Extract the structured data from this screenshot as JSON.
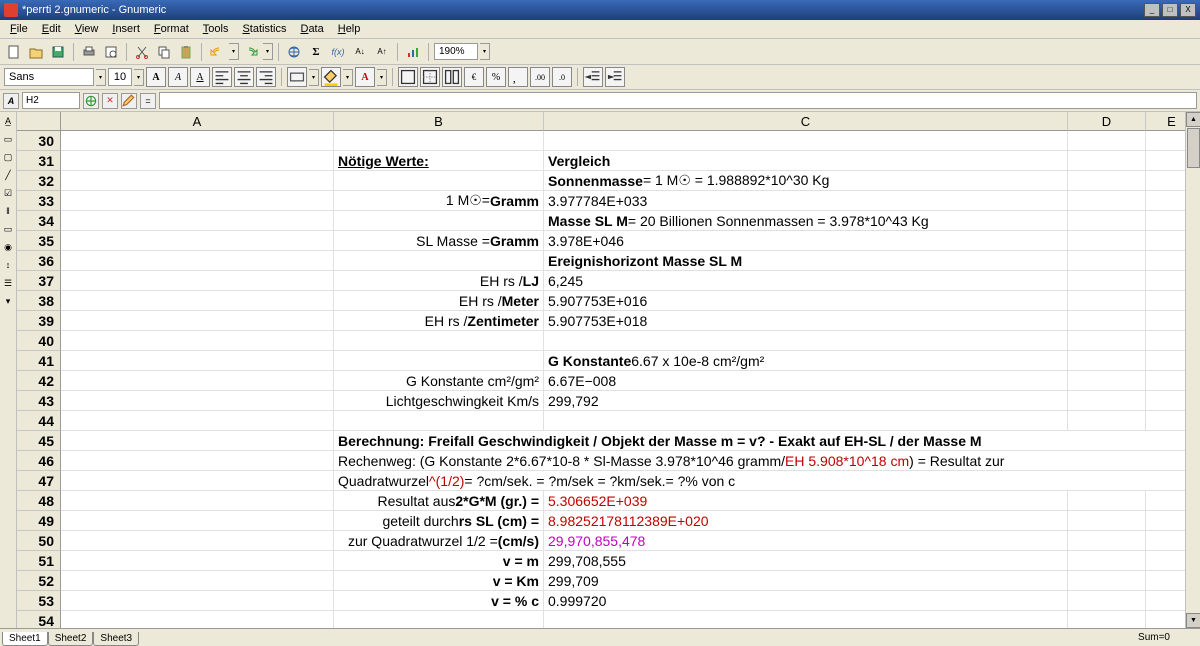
{
  "app": {
    "title": "*perrti 2.gnumeric - Gnumeric",
    "window_buttons": {
      "min": "_",
      "max": "□",
      "close": "X"
    }
  },
  "menus": [
    "File",
    "Edit",
    "View",
    "Insert",
    "Format",
    "Tools",
    "Statistics",
    "Data",
    "Help"
  ],
  "zoom": "190%",
  "font": {
    "name": "Sans",
    "size": "10"
  },
  "cellref": "H2",
  "columns": [
    "A",
    "B",
    "C",
    "D",
    "E"
  ],
  "rows_start": 30,
  "rows_count": 26,
  "cells": {
    "31": {
      "B": {
        "t": "Nötige Werte:",
        "cls": "bold uline"
      },
      "C": {
        "t": "Vergleich",
        "cls": "bold"
      }
    },
    "32": {
      "C": {
        "html": "<b>Sonnenmasse</b> = 1 M☉ = 1.988892*10^30 Kg"
      }
    },
    "33": {
      "B": {
        "html": "1 M☉= <b>Gramm</b>",
        "cls": "right"
      },
      "C": {
        "t": "3.977784E+033"
      }
    },
    "34": {
      "C": {
        "html": "<b>Masse SL M</b> = 20 Billionen Sonnenmassen = 3.978*10^43 Kg"
      }
    },
    "35": {
      "B": {
        "html": "SL Masse = <b>Gramm</b>",
        "cls": "right"
      },
      "C": {
        "t": "3.978E+046"
      }
    },
    "36": {
      "C": {
        "t": "Ereignishorizont Masse SL M",
        "cls": "bold"
      }
    },
    "37": {
      "B": {
        "html": "EH rs / <b>LJ</b>",
        "cls": "right"
      },
      "C": {
        "t": "6,245"
      }
    },
    "38": {
      "B": {
        "html": "EH rs / <b>Meter</b>",
        "cls": "right"
      },
      "C": {
        "t": "5.907753E+016"
      }
    },
    "39": {
      "B": {
        "html": "EH rs / <b>Zentimeter</b>",
        "cls": "right"
      },
      "C": {
        "t": "5.907753E+018"
      }
    },
    "41": {
      "C": {
        "html": "<b>G Konstante</b> 6.67 x 10e-8 cm²/gm²"
      }
    },
    "42": {
      "B": {
        "t": "G Konstante cm²/gm²",
        "cls": "right"
      },
      "C": {
        "t": "6.67E−008"
      }
    },
    "43": {
      "B": {
        "t": "Lichtgeschwingkeit Km/s",
        "cls": "right"
      },
      "C": {
        "t": "299,792"
      }
    },
    "45": {
      "B": {
        "t": "Berechnung: Freifall Geschwindigkeit / Objekt der Masse m = v? - Exakt auf  EH-SL / der Masse M",
        "cls": "bold",
        "span": true
      }
    },
    "46": {
      "B": {
        "html": "Rechenweg: (G Konstante 2*6.67*10-8 * Sl-Masse 3.978*10^46 gramm/<span class='red'>EH 5.908*10^18 cm</span> ) = Resultat zur",
        "span": true
      }
    },
    "47": {
      "B": {
        "html": "Quadratwurzel <span class='red'>^(1/2)</span> = ?cm/sek. = ?m/sek = ?km/sek.= ?% von c",
        "span": true
      }
    },
    "48": {
      "B": {
        "html": "Resultat aus <b>2*G*M (gr.) =</b>",
        "cls": "right"
      },
      "C": {
        "t": "5.306652E+039",
        "cls": "red"
      }
    },
    "49": {
      "B": {
        "html": "geteilt durch <b>rs SL (cm) =</b>",
        "cls": "right"
      },
      "C": {
        "t": "8.98252178112389E+020",
        "cls": "red"
      }
    },
    "50": {
      "B": {
        "html": "zur Quadratwurzel 1/2 = <b>(cm/s)</b>",
        "cls": "right"
      },
      "C": {
        "t": "29,970,855,478",
        "cls": "mag"
      }
    },
    "51": {
      "B": {
        "t": "v = m",
        "cls": "right bold"
      },
      "C": {
        "t": "299,708,555"
      }
    },
    "52": {
      "B": {
        "t": "v = Km",
        "cls": "right bold"
      },
      "C": {
        "t": "299,709"
      }
    },
    "53": {
      "B": {
        "t": "v = % c",
        "cls": "right bold"
      },
      "C": {
        "t": "0.999720"
      }
    }
  },
  "sheets": [
    "Sheet1",
    "Sheet2",
    "Sheet3"
  ],
  "status": {
    "sum": "Sum=0"
  }
}
